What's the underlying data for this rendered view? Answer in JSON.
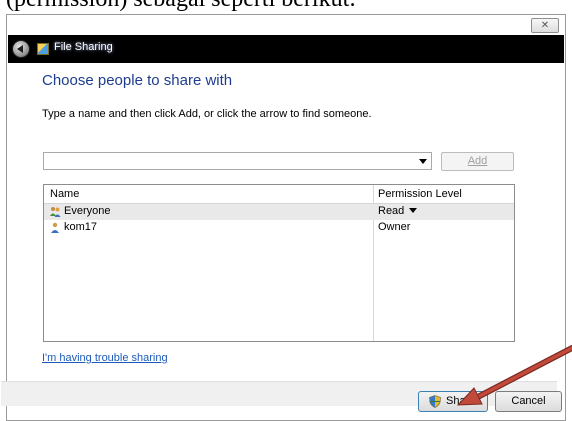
{
  "document": {
    "caption_fragment": "(permission) sebagai seperti berikut:"
  },
  "window": {
    "close_glyph": "✕",
    "title": "File Sharing",
    "back_icon": "back-arrow-icon",
    "app_icon": "file-sharing-icon"
  },
  "dialog": {
    "heading": "Choose people to share with",
    "instruction": "Type a name and then click Add, or click the arrow to find someone.",
    "name_input": {
      "value": "",
      "placeholder": ""
    },
    "add_label": "Add",
    "columns": [
      "Name",
      "Permission Level"
    ],
    "rows": [
      {
        "name": "Everyone",
        "permission": "Read",
        "icon": "users-group-icon",
        "selected": true,
        "has_dropdown": true
      },
      {
        "name": "kom17",
        "permission": "Owner",
        "icon": "user-icon",
        "selected": false,
        "has_dropdown": false
      }
    ],
    "help_link": "I'm having trouble sharing"
  },
  "footer": {
    "share_label": "Share",
    "share_icon": "uac-shield-icon",
    "cancel_label": "Cancel"
  },
  "annotation": {
    "arrow_color": "#c0392b",
    "points_to": "share-button"
  }
}
